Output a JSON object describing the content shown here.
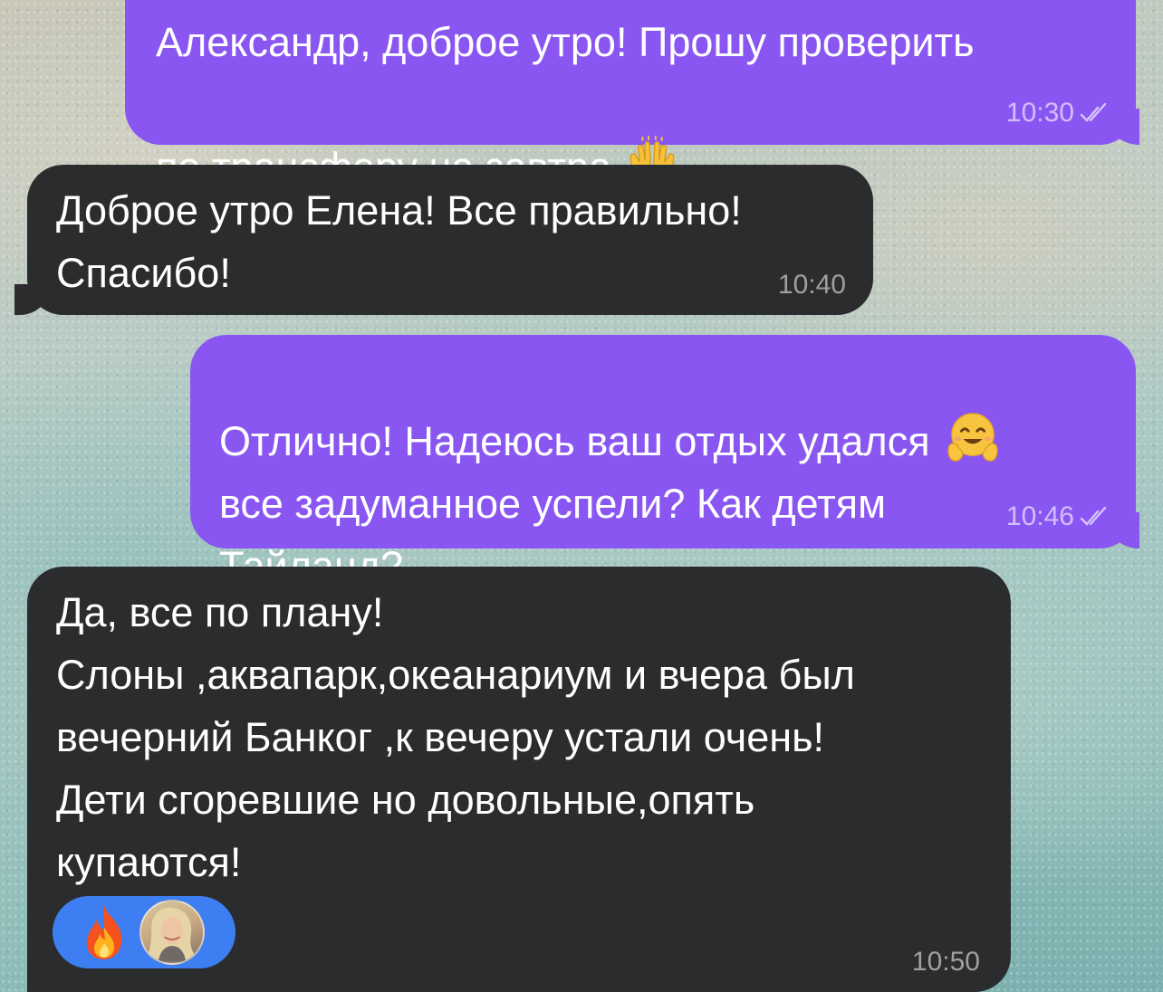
{
  "messages": [
    {
      "direction": "outgoing",
      "text": "Александр, доброе утро! Прошу проверить\nпо трансферу на завтра",
      "emoji": "raising-hands-emoji",
      "time": "10:30",
      "status": "read"
    },
    {
      "direction": "incoming",
      "text": "Доброе утро Елена! Все правильно!\nСпасибо!",
      "time": "10:40"
    },
    {
      "direction": "outgoing",
      "text_line1": "Отлично! Надеюсь ваш отдых удался",
      "emoji": "hugging-face-emoji",
      "text_rest": "все задуманное успели? Как детям\nТайланд?",
      "time": "10:46",
      "status": "read"
    },
    {
      "direction": "incoming",
      "text": "Да, все по плану!\nСлоны ,аквапарк,океанариум и вчера был\nвечерний Банког ,к вечеру устали очень!\nДети сгоревшие но довольные,опять\nкупаются!",
      "time": "10:50",
      "reaction": {
        "emoji": "fire-emoji",
        "by": "user-avatar"
      }
    }
  ],
  "colors": {
    "outgoing_bubble": "#8a56f2",
    "incoming_bubble": "#2b2c2d",
    "reaction_pill": "#3d7ff2"
  }
}
